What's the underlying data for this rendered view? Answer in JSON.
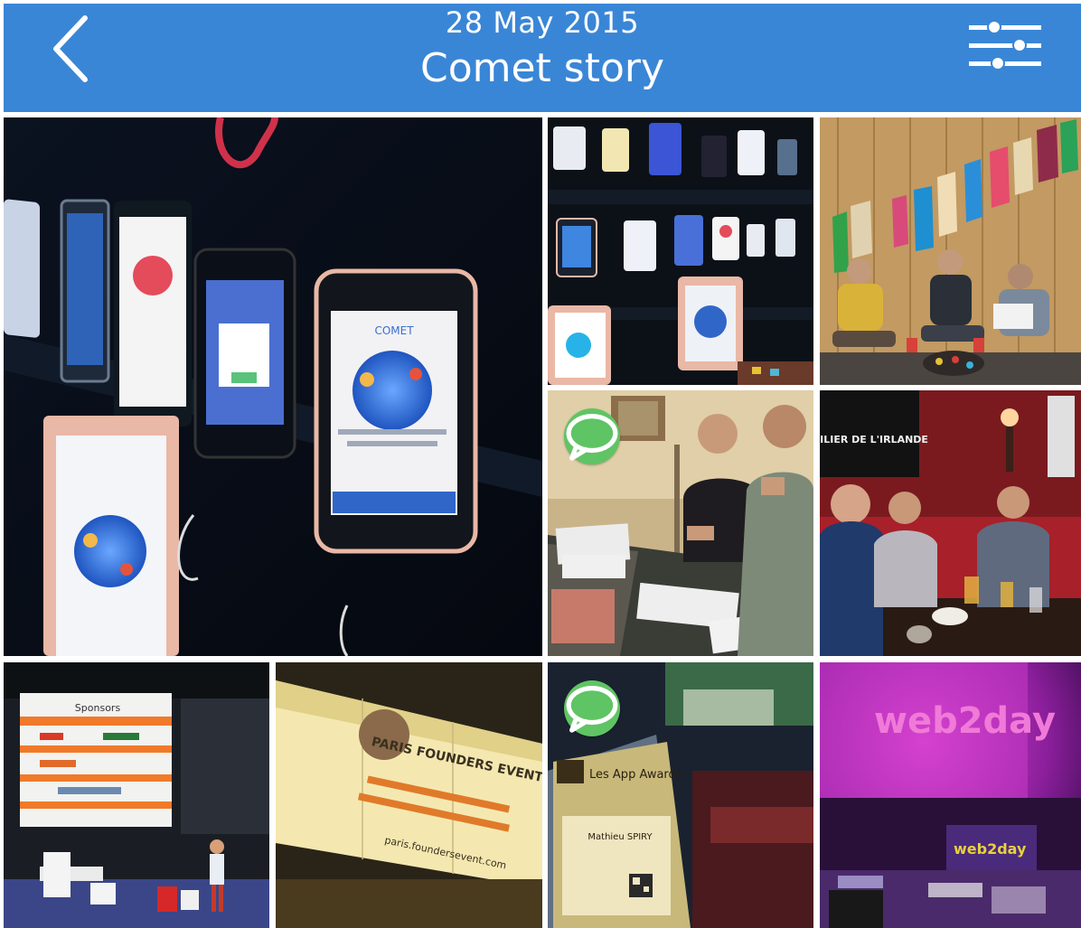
{
  "header": {
    "date": "28 May 2015",
    "title": "Comet story",
    "back_icon": "chevron-left-icon",
    "filter_icon": "sliders-icon",
    "background": "#3a86d6"
  },
  "photos": [
    {
      "id": "phones-wall-large",
      "has_chat": false
    },
    {
      "id": "phones-wall-small",
      "has_chat": false
    },
    {
      "id": "team-wooden-room",
      "has_chat": false
    },
    {
      "id": "meeting-table",
      "has_chat": true
    },
    {
      "id": "pub-pilier",
      "has_chat": false
    },
    {
      "id": "conference-sponsors",
      "has_chat": false
    },
    {
      "id": "founders-event-screen",
      "has_chat": false
    },
    {
      "id": "app-awards-badge",
      "has_chat": true
    },
    {
      "id": "web2day-stage",
      "has_chat": false
    }
  ],
  "texts": {
    "pub_sign": "PILIER DE L'IRLANDE",
    "comet_label": "COMET",
    "sponsors_label": "Sponsors",
    "founders_label": "PARIS FOUNDERS EVENT",
    "founders_url": "paris.foundersevent.com",
    "awards_label": "Les App Awards",
    "awards_name": "Mathieu SPIRY",
    "web2day_label": "web2day"
  },
  "badge_color": "#5fc464"
}
